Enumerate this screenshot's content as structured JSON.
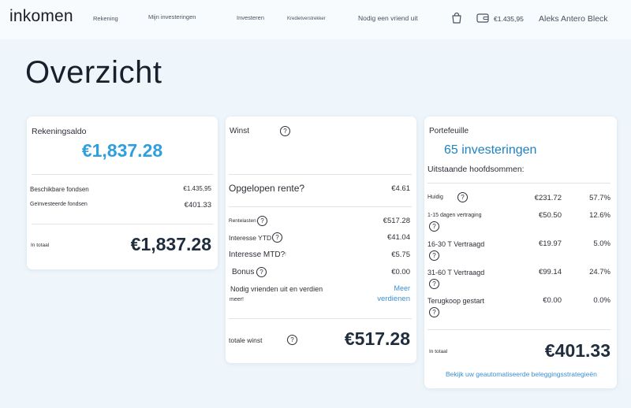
{
  "nav": {
    "logo": "inkomen",
    "rekening": "Rekening",
    "mijn_investeringen": "Mijn investeringen",
    "investeren": "Investeren",
    "kredietverstrekker": "Kredietverstrekker",
    "invite": "Nodig een vriend uit",
    "balance": "€1.435,95",
    "user": "Aleks Antero Bleck"
  },
  "page": {
    "title": "Overzicht"
  },
  "rekeningssaldo": {
    "title": "Rekeningsaldo",
    "amount": "€1,837.28",
    "available_label": "Beschikbare fondsen",
    "available_value": "€1.435,95",
    "invested_label": "Geïnvesteerde fondsen",
    "invested_value": "€401.33",
    "total_label": "In totaal",
    "total_value": "€1,837.28"
  },
  "winst": {
    "title": "Winst",
    "accrued_label": "Opgelopen rente?",
    "accrued_value": "€4.61",
    "interest_label": "Rentelasten",
    "interest_value": "€517.28",
    "ytd_label": "Interesse YTD",
    "ytd_value": "€41.04",
    "mtd_label": "Interesse MTD?",
    "mtd_sep": "!",
    "mtd_value": "€5.75",
    "bonus_label": "Bonus",
    "bonus_value": "€0.00",
    "invite_line1": "Nodig vrienden uit en verdien",
    "invite_line2": "meer!",
    "more_line1": "Meer",
    "more_line2": "verdienen",
    "total_label": "totale winst",
    "total_value": "€517.28"
  },
  "portefeuille": {
    "title": "Portefeuille",
    "count": "65 investeringen",
    "subtitle": "Uitstaande hoofdsommen:",
    "rows": [
      {
        "label": "Huidig",
        "amount": "€231.72",
        "pct": "57.7%"
      },
      {
        "label": "1-15 dagen vertraging",
        "amount": "€50.50",
        "pct": "12.6%"
      },
      {
        "label": "16-30 T Vertraagd",
        "amount": "€19.97",
        "pct": "5.0%"
      },
      {
        "label": "31-60 T Vertraagd",
        "amount": "€99.14",
        "pct": "24.7%"
      },
      {
        "label": "Terugkoop gestart",
        "amount": "€0.00",
        "pct": "0.0%"
      }
    ],
    "total_label": "In totaal",
    "total_value": "€401.33",
    "strategy_link": "Bekijk uw geautomatiseerde beleggingsstrategieën"
  },
  "help_glyph": "?"
}
